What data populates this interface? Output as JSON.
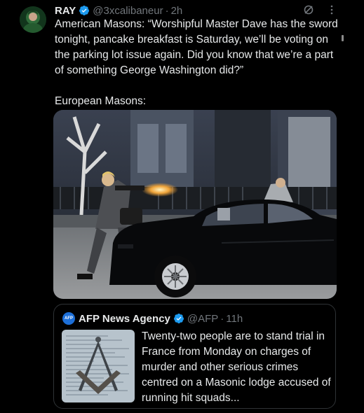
{
  "tweet": {
    "display_name": "RAY",
    "handle": "@3xcalibaneur",
    "separator": "·",
    "time": "2h",
    "text_line1": "American Masons: “Worshipful Master Dave has the sword tonight, pancake breakfast is Saturday, we’ll be voting on the parking lot issue again. Did you know that we’re a part of something George Washington did?”",
    "text_line2": "European Masons:"
  },
  "quote": {
    "avatar_text": "AFP",
    "display_name": "AFP News Agency",
    "handle": "@AFP",
    "separator": "·",
    "time": "11h",
    "text": "Twenty-two people are to stand trial in France from Monday on charges of murder and other serious crimes centred on a Masonic lodge accused of running hit squads..."
  },
  "icons": {
    "verified": "verified-badge-icon",
    "grok": "grok-icon",
    "more": "more-icon"
  },
  "colors": {
    "background": "#000000",
    "text": "#e7e9ea",
    "secondary": "#71767b",
    "verified": "#1d9bf0",
    "border": "#2f3336"
  }
}
